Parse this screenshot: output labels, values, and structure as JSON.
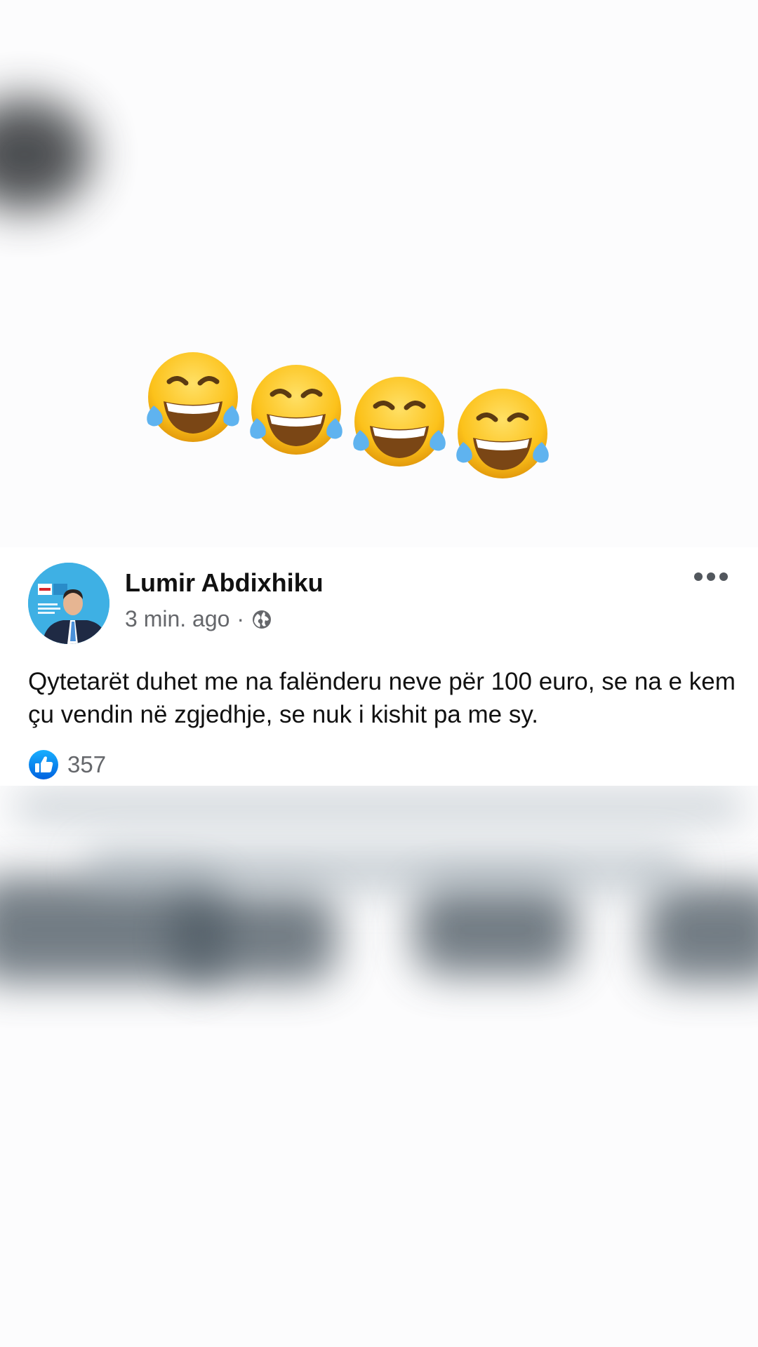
{
  "post": {
    "author": "Lumir Abdixhiku",
    "time_label": "3 min. ago",
    "separator": "·",
    "audience_icon": "globe-icon",
    "text": "Qytetarët duhet me na falënderu neve për 100 euro, se na e kem çu vendin në zgjedhje, se nuk i kishit pa me sy.",
    "reaction_icon": "like-icon",
    "like_count": "357"
  },
  "emoji": {
    "icon": "face-with-tears-of-joy-icon",
    "count": 4
  },
  "colors": {
    "facebook_blue": "#1877f2",
    "emoji_yellow": "#fcc21b",
    "text_secondary": "#65676b"
  }
}
